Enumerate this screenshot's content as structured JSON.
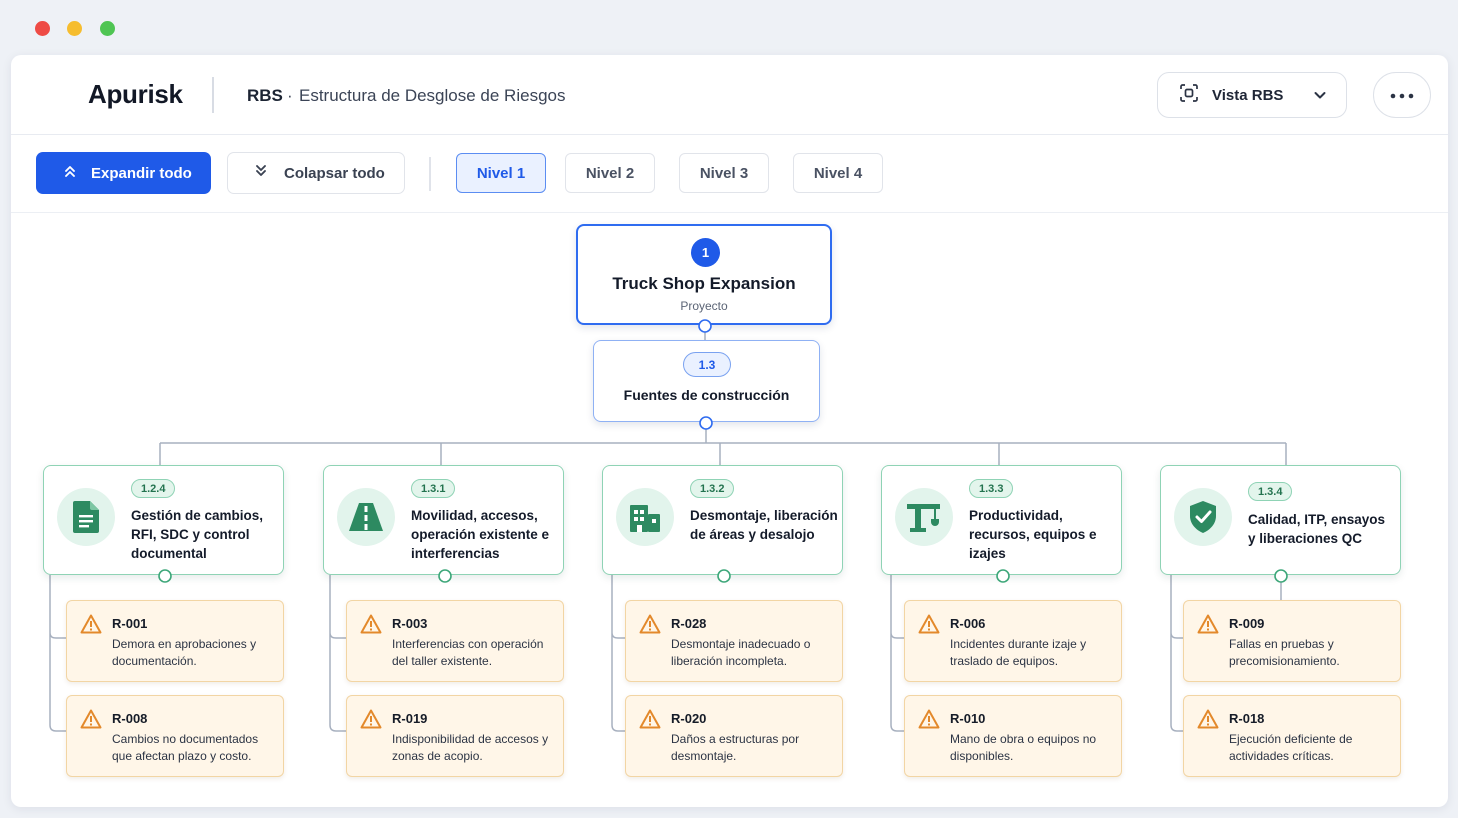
{
  "window_controls": [
    "close",
    "minimize",
    "maximize"
  ],
  "header": {
    "app_name": "Apurisk",
    "breadcrumb_main": "RBS",
    "breadcrumb_separator": "·",
    "breadcrumb_sub": "Estructura de Desglose de Riesgos",
    "view_selector": {
      "label": "Vista RBS",
      "icon": "scan-icon"
    },
    "more_button_icon": "ellipsis-icon"
  },
  "toolbar": {
    "expand_label": "Expandir todo",
    "collapse_label": "Colapsar todo",
    "levels": [
      {
        "label": "Nivel 1",
        "active": true
      },
      {
        "label": "Nivel 2",
        "active": false
      },
      {
        "label": "Nivel 3",
        "active": false
      },
      {
        "label": "Nivel 4",
        "active": false
      }
    ]
  },
  "tree": {
    "root": {
      "number": "1",
      "title": "Truck Shop Expansion",
      "subtitle": "Proyecto"
    },
    "source": {
      "code": "1.3",
      "title": "Fuentes de construcción"
    },
    "categories": [
      {
        "code": "1.2.4",
        "title": "Gestión de cambios, RFI, SDC y control documental",
        "icon": "document-icon",
        "risks": [
          {
            "id": "R-001",
            "description": "Demora en aprobaciones y documentación."
          },
          {
            "id": "R-008",
            "description": "Cambios no documentados que afectan plazo y costo."
          }
        ]
      },
      {
        "code": "1.3.1",
        "title": "Movilidad, accesos, operación existente e interferencias",
        "icon": "road-icon",
        "risks": [
          {
            "id": "R-003",
            "description": "Interferencias con operación del taller existente."
          },
          {
            "id": "R-019",
            "description": "Indisponibilidad de accesos y zonas de acopio."
          }
        ]
      },
      {
        "code": "1.3.2",
        "title": "Desmontaje, liberación de áreas y desalojo",
        "icon": "building-icon",
        "risks": [
          {
            "id": "R-028",
            "description": "Desmontaje inadecuado o liberación incompleta."
          },
          {
            "id": "R-020",
            "description": "Daños a estructuras por desmontaje."
          }
        ]
      },
      {
        "code": "1.3.3",
        "title": "Productividad, recursos, equipos e izajes",
        "icon": "crane-icon",
        "risks": [
          {
            "id": "R-006",
            "description": "Incidentes durante izaje y traslado de equipos."
          },
          {
            "id": "R-010",
            "description": "Mano de obra o equipos no disponibles."
          }
        ]
      },
      {
        "code": "1.3.4",
        "title": "Calidad, ITP, ensayos y liberaciones QC",
        "icon": "shield-check-icon",
        "risks": [
          {
            "id": "R-009",
            "description": "Fallas en pruebas y precomisionamiento."
          },
          {
            "id": "R-018",
            "description": "Ejecución deficiente de actividades críticas."
          }
        ]
      }
    ]
  },
  "colors": {
    "primary": "#1f5ae8",
    "category_border": "#8fd3b5",
    "category_icon": "#2d8a61",
    "risk_background": "#fff6e8",
    "warning": "#e3892b"
  }
}
